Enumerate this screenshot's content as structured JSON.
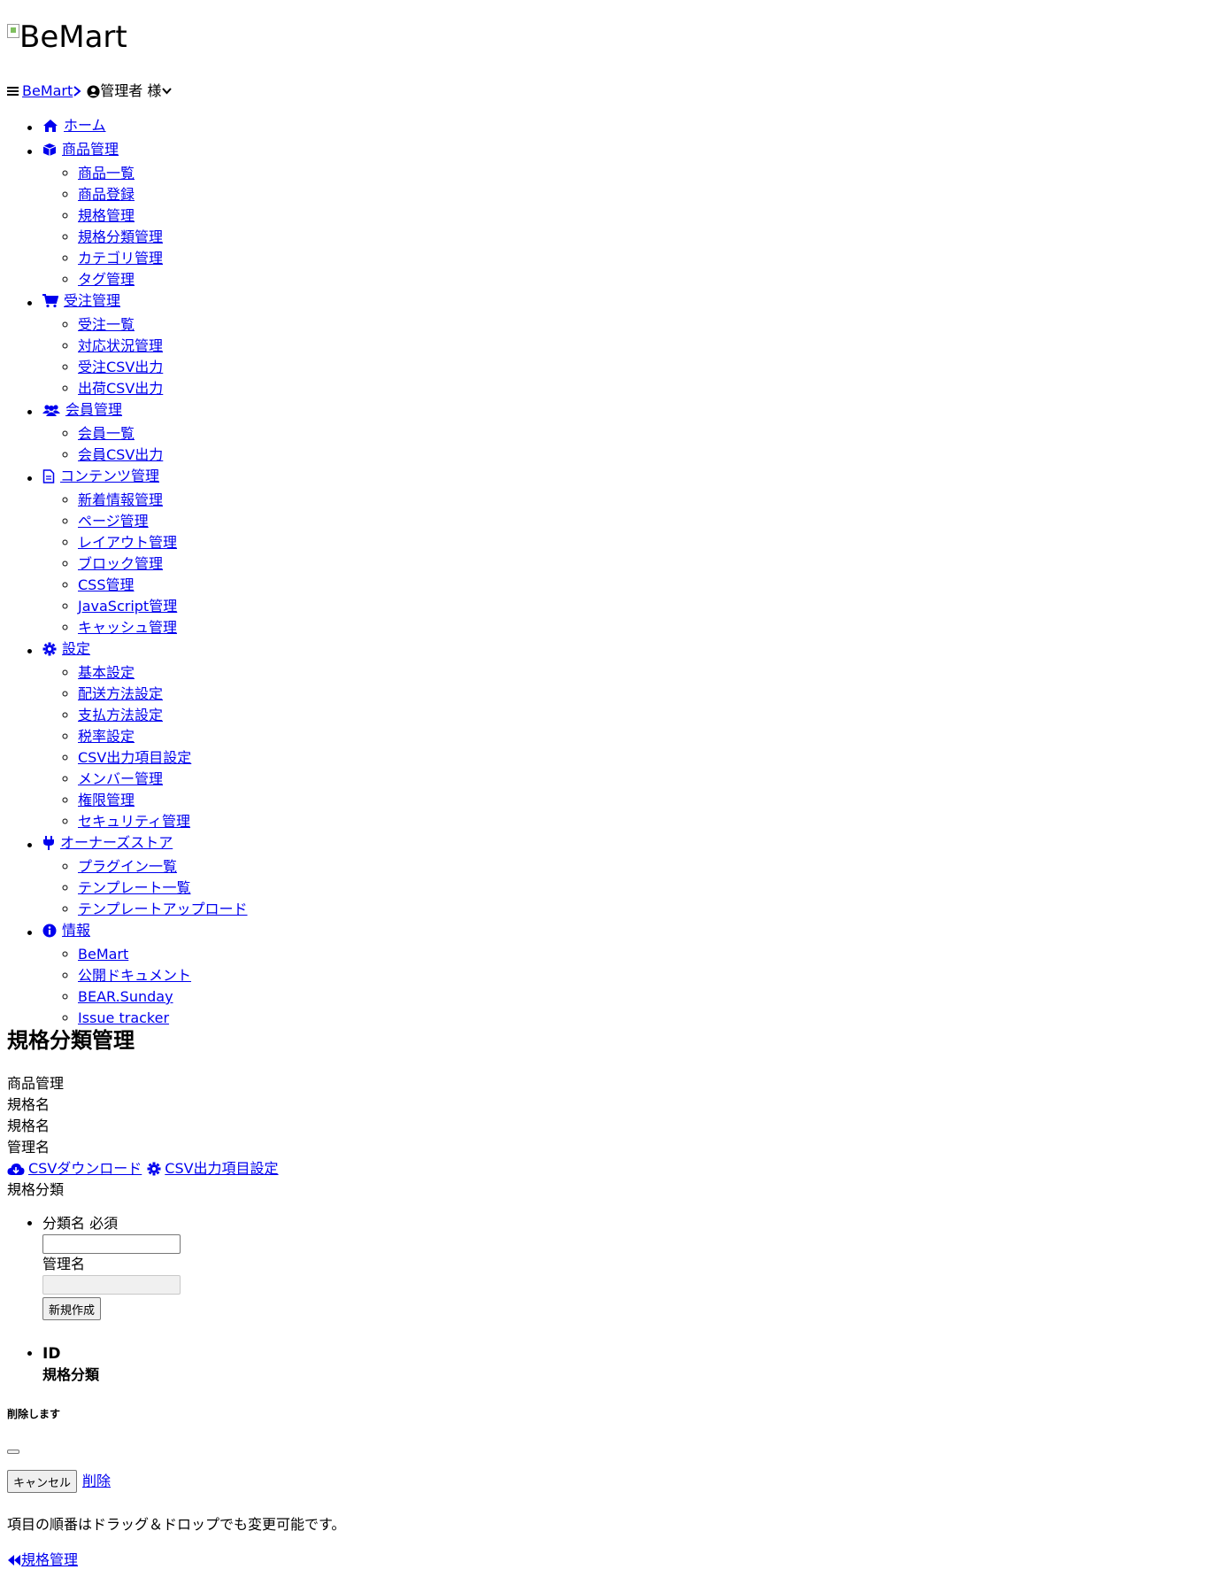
{
  "brand": {
    "logo_alt": "BeMart"
  },
  "topbar": {
    "breadcrumb_link": "BeMart",
    "user_label": "管理者 様"
  },
  "nav": [
    {
      "label": "ホーム",
      "icon": "home-icon",
      "items": []
    },
    {
      "label": "商品管理",
      "icon": "box-icon",
      "items": [
        "商品一覧",
        "商品登録",
        "規格管理",
        "規格分類管理",
        "カテゴリ管理",
        "タグ管理"
      ]
    },
    {
      "label": "受注管理",
      "icon": "cart-icon",
      "items": [
        "受注一覧",
        "対応状況管理",
        "受注CSV出力",
        "出荷CSV出力"
      ]
    },
    {
      "label": "会員管理",
      "icon": "users-icon",
      "items": [
        "会員一覧",
        "会員CSV出力"
      ]
    },
    {
      "label": "コンテンツ管理",
      "icon": "file-icon",
      "items": [
        "新着情報管理",
        "ページ管理",
        "レイアウト管理",
        "ブロック管理",
        "CSS管理",
        "JavaScript管理",
        "キャッシュ管理"
      ]
    },
    {
      "label": "設定",
      "icon": "gear-icon",
      "items": [
        "基本設定",
        "配送方法設定",
        "支払方法設定",
        "税率設定",
        "CSV出力項目設定",
        "メンバー管理",
        "権限管理",
        "セキュリティ管理"
      ]
    },
    {
      "label": "オーナーズストア",
      "icon": "plug-icon",
      "items": [
        "プラグイン一覧",
        "テンプレート一覧",
        "テンプレートアップロード"
      ]
    },
    {
      "label": "情報",
      "icon": "info-icon",
      "items": [
        "BeMart",
        "公開ドキュメント",
        "BEAR.Sunday",
        "Issue tracker"
      ]
    }
  ],
  "page": {
    "title": "規格分類管理",
    "meta_lines": [
      "商品管理",
      "規格名",
      "規格名",
      "管理名"
    ],
    "csv_download": "CSVダウンロード",
    "csv_settings": "CSV出力項目設定",
    "section_label": "規格分類"
  },
  "form": {
    "name_label": "分類名 必須",
    "admin_label": "管理名",
    "create_button": "新規作成",
    "col_id": "ID",
    "col_name": "規格分類"
  },
  "modal": {
    "title": "削除します",
    "cancel": "キャンセル",
    "delete": "削除"
  },
  "note": "項目の順番はドラッグ＆ドロップでも変更可能です。",
  "back_link": "規格管理"
}
